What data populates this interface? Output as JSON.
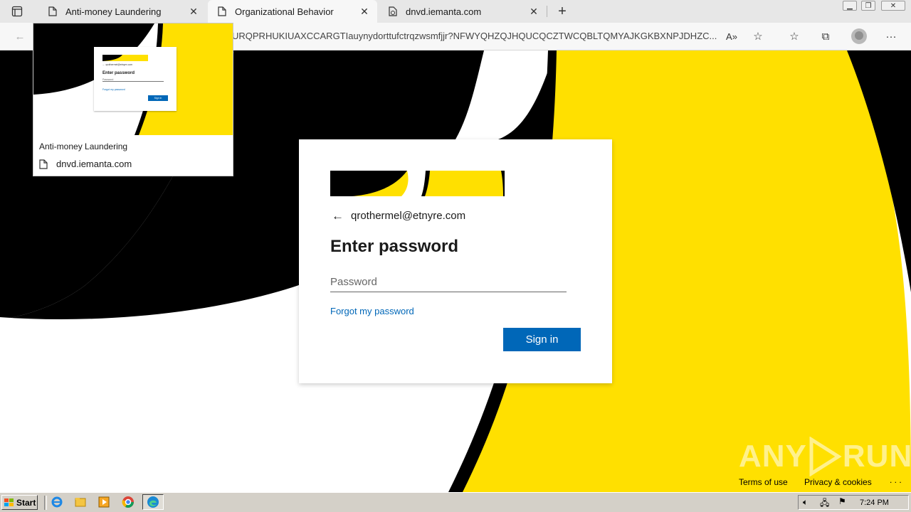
{
  "browser": {
    "tabs": [
      {
        "label": "Anti-money Laundering",
        "active": false
      },
      {
        "label": "Organizational Behavior",
        "active": true
      },
      {
        "label": "dnvd.iemanta.com",
        "active": false
      }
    ],
    "url": "URQPRHUKIUAXCCARGTIauynydorttufctrqzwsmfjjr?NFWYQHZQJHQUCQCZTWCQBLTQMYAJKGKBXNPJDHZC...",
    "read_aloud_icon_text": "A»"
  },
  "tab_preview": {
    "title": "Anti-money Laundering",
    "host": "dnvd.iemanta.com",
    "thumb": {
      "email": "qrothermel@etnyre.com",
      "heading": "Enter password",
      "placeholder": "Password",
      "forgot": "Forgot my password",
      "button": "Sign in"
    }
  },
  "signin": {
    "email": "qrothermel@etnyre.com",
    "heading": "Enter password",
    "password_placeholder": "Password",
    "password_value": "",
    "forgot_link": "Forgot my password",
    "signin_button": "Sign in"
  },
  "footer": {
    "terms": "Terms of use",
    "privacy": "Privacy & cookies",
    "more": ". . ."
  },
  "watermark": {
    "left": "ANY",
    "right": "RUN"
  },
  "taskbar": {
    "start_label": "Start",
    "clock": "7:24 PM",
    "apps": [
      "internet-explorer-icon",
      "file-explorer-icon",
      "media-player-icon",
      "chrome-icon",
      "edge-icon"
    ]
  },
  "colors": {
    "brand_yellow": "#ffe000",
    "brand_black": "#000000",
    "button_blue": "#0067b8",
    "link_blue": "#0067b8"
  }
}
